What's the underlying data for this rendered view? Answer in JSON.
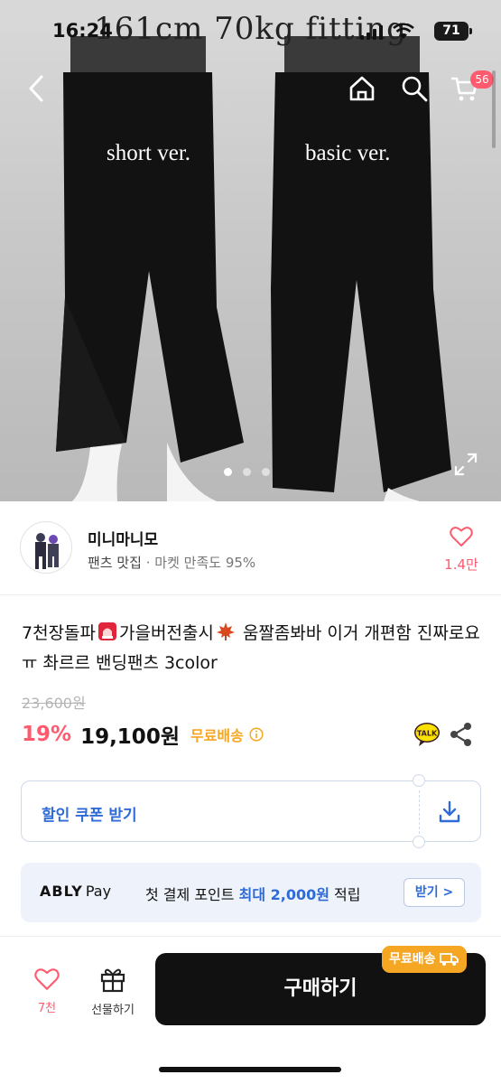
{
  "status_bar": {
    "time": "16:24",
    "battery": "71"
  },
  "hero": {
    "title": "161cm 70kg fitting",
    "labels": {
      "short": "short ver.",
      "basic": "basic ver."
    },
    "carousel_dots": 3
  },
  "nav": {
    "cart_count": "56"
  },
  "seller": {
    "name": "미니마니모",
    "category": "팬츠 맛집",
    "satisfaction": "· 마켓 만족도 95%",
    "likes": "1.4만"
  },
  "product": {
    "title_part1": "7천장돌파",
    "title_part2": "가을버전출시",
    "title_part3": "움짤좀봐바 이거 개편함 진짜로요ㅠ 촤르르 밴딩팬츠 3color",
    "original_price": "23,600원",
    "discount": "19%",
    "price": "19,100원",
    "shipping": "무료배송"
  },
  "coupon": {
    "label": "할인 쿠폰 받기"
  },
  "ably": {
    "logo": "ABLY",
    "pay": "Pay",
    "text_before": "첫 결제 포인트",
    "highlight": "최대 2,000원",
    "text_after": "적립",
    "button": "받기 >"
  },
  "bottom": {
    "like_count": "7천",
    "gift_label": "선물하기",
    "buy_label": "구매하기",
    "free_badge": "무료배송"
  },
  "colors": {
    "accent_pink": "#ff5a6e",
    "accent_blue": "#2f6bd8",
    "accent_orange": "#f5a623"
  }
}
